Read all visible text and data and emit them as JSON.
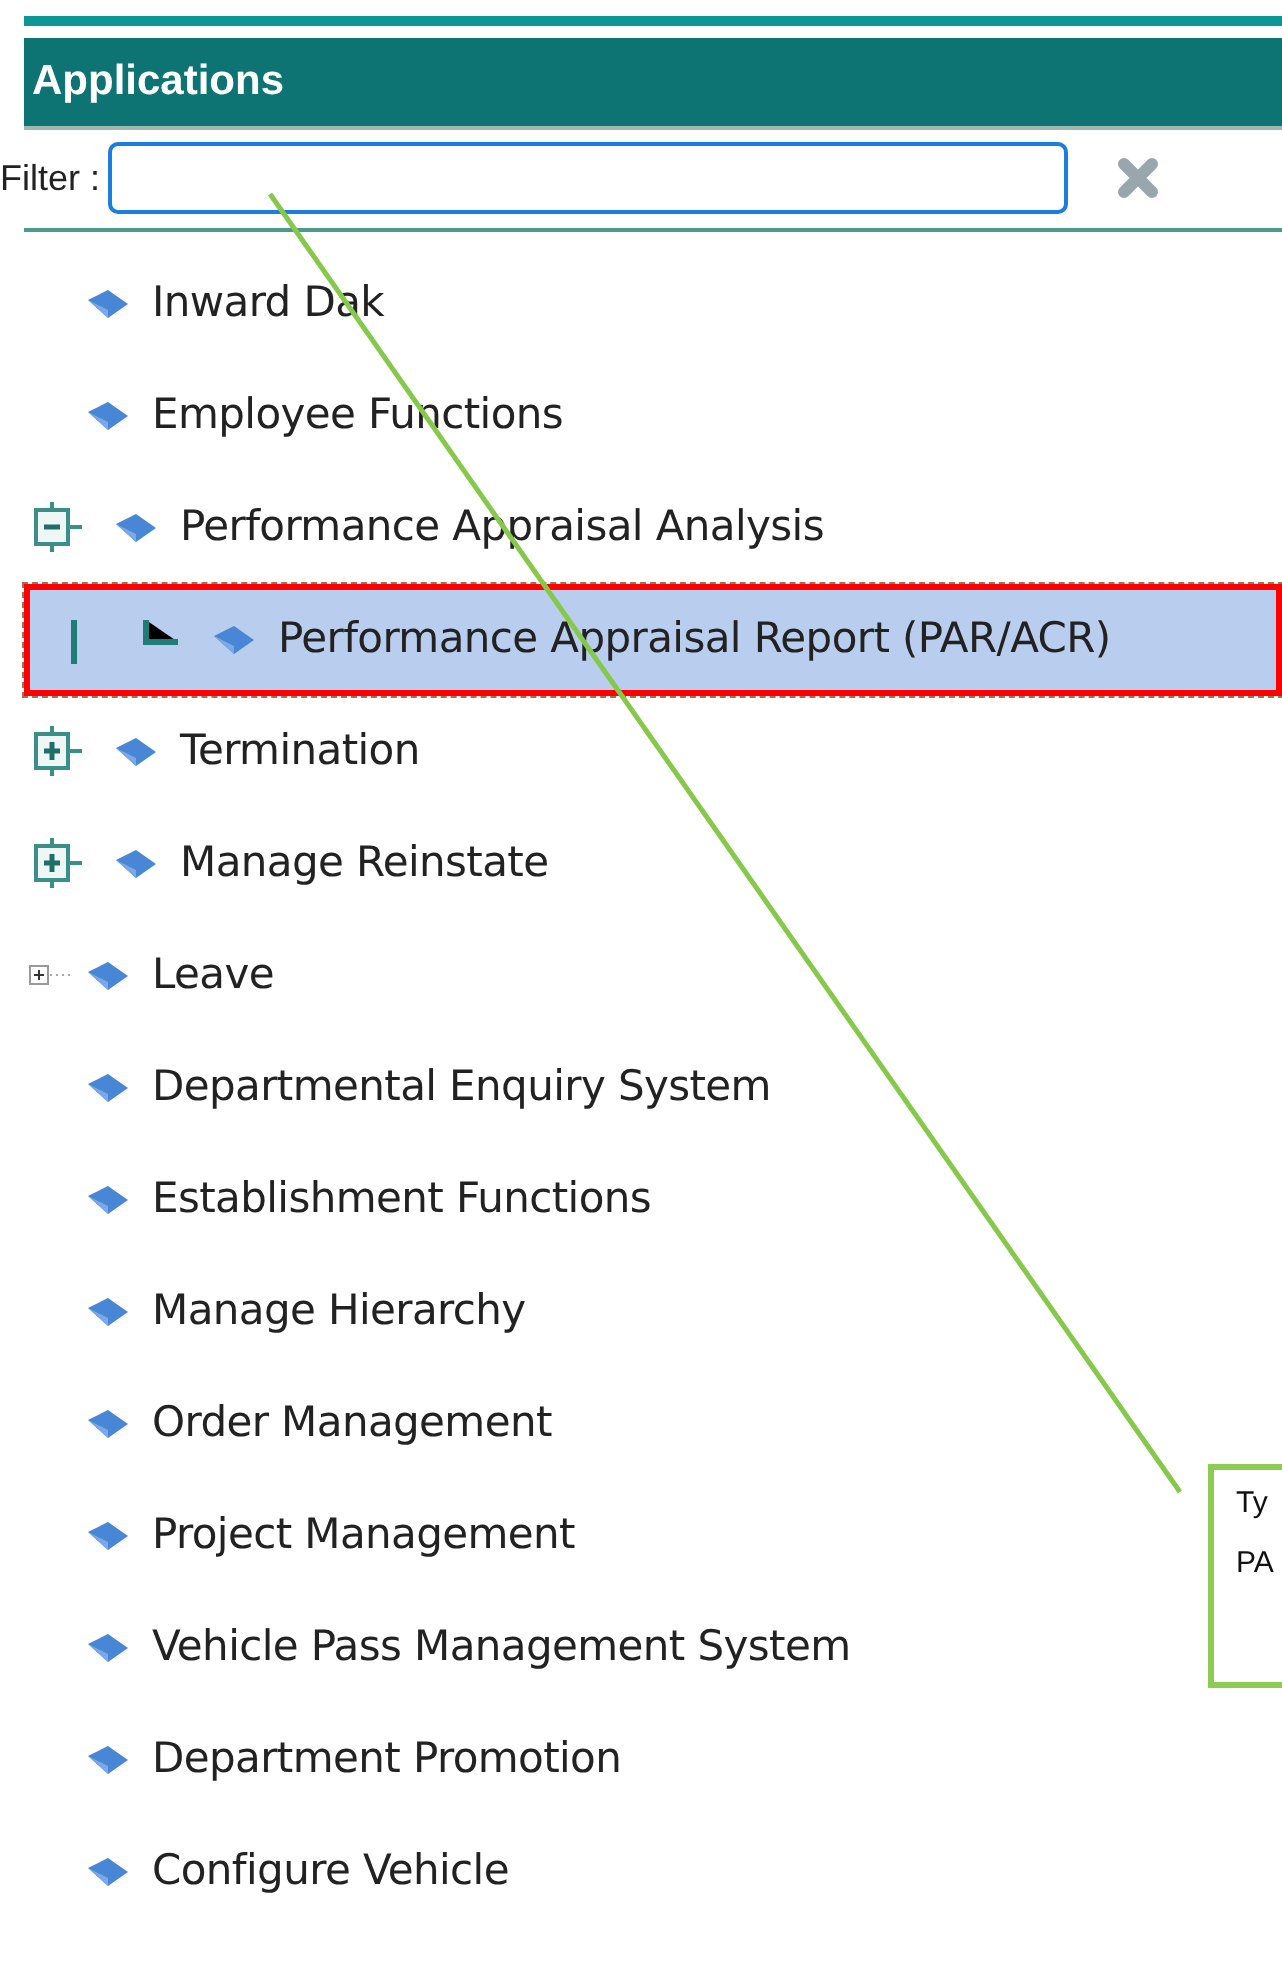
{
  "panel": {
    "title": "Applications"
  },
  "filter": {
    "label": "Filter :"
  },
  "tree": [
    {
      "label": "Inward Dak",
      "selected": false
    },
    {
      "label": "Employee Functions",
      "selected": false
    },
    {
      "label": "Performance Appraisal Analysis",
      "selected": false,
      "expanded": true,
      "kind": "boxed",
      "children": [
        {
          "label": "Performance Appraisal Report (PAR/ACR)",
          "selected": true
        }
      ]
    },
    {
      "label": "Termination",
      "selected": false,
      "expanded": false,
      "kind": "boxed"
    },
    {
      "label": "Manage Reinstate",
      "selected": false,
      "expanded": false,
      "kind": "boxed"
    },
    {
      "label": "Leave",
      "selected": false,
      "expanded": false,
      "kind": "plain"
    },
    {
      "label": "Departmental Enquiry System",
      "selected": false
    },
    {
      "label": "Establishment Functions",
      "selected": false
    },
    {
      "label": "Manage Hierarchy",
      "selected": false
    },
    {
      "label": "Order Management",
      "selected": false
    },
    {
      "label": "Project Management",
      "selected": false
    },
    {
      "label": "Vehicle Pass Management System",
      "selected": false
    },
    {
      "label": "Department Promotion",
      "selected": false
    },
    {
      "label": "Configure Vehicle",
      "selected": false
    }
  ],
  "callout": {
    "lines": [
      "Ty",
      "PA"
    ]
  }
}
